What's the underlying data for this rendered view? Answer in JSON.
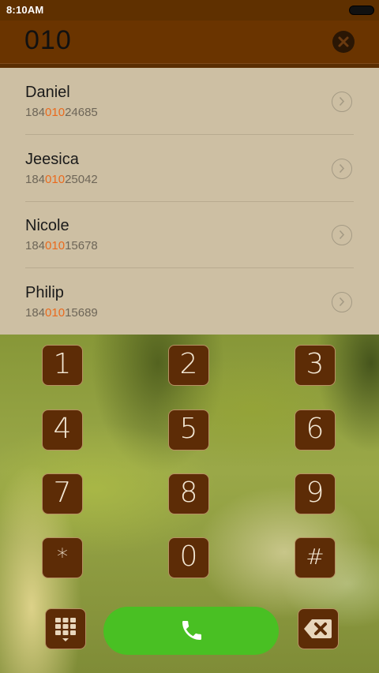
{
  "status_bar": {
    "time": "8:10AM"
  },
  "header": {
    "dialed": "010"
  },
  "results": [
    {
      "name": "Daniel",
      "prefix": "184",
      "match": "010",
      "suffix": "24685"
    },
    {
      "name": "Jeesica",
      "prefix": "184",
      "match": "010",
      "suffix": "25042"
    },
    {
      "name": "Nicole",
      "prefix": "184",
      "match": "010",
      "suffix": "15678"
    },
    {
      "name": "Philip",
      "prefix": "184",
      "match": "010",
      "suffix": "15689"
    }
  ],
  "keypad": {
    "k1": "1",
    "k2": "2",
    "k3": "3",
    "k4": "4",
    "k5": "5",
    "k6": "6",
    "k7": "7",
    "k8": "8",
    "k9": "9",
    "kstar": "*",
    "k0": "0",
    "khash": "#"
  },
  "colors": {
    "accent_match": "#ea6a1d",
    "call_button": "#49c023",
    "header": "#6a3400",
    "key_fill": "#5d2c06"
  },
  "icons": {
    "clear": "clear-circle-icon",
    "row_action": "chevron-right-icon",
    "keypad_toggle": "dialpad-grid-icon",
    "call": "phone-icon",
    "backspace": "backspace-icon",
    "battery": "battery-icon"
  }
}
